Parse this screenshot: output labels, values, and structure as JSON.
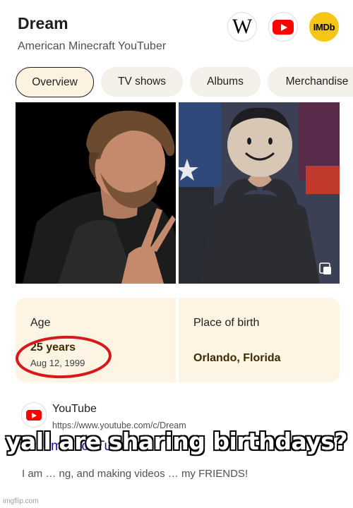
{
  "header": {
    "title": "Dream",
    "subtitle": "American Minecraft YouTuber"
  },
  "external_links": [
    {
      "name": "wikipedia",
      "glyph": "W"
    },
    {
      "name": "youtube",
      "glyph": ""
    },
    {
      "name": "imdb",
      "glyph": "IMDb"
    }
  ],
  "tabs": [
    {
      "label": "Overview",
      "active": true
    },
    {
      "label": "TV shows",
      "active": false
    },
    {
      "label": "Albums",
      "active": false
    },
    {
      "label": "Merchandise",
      "active": false
    }
  ],
  "images": [
    {
      "icon": "photo-of-person-making-peace-sign"
    },
    {
      "icon": "photo-of-masked-person-making-heart-hands"
    }
  ],
  "facts": {
    "age": {
      "label": "Age",
      "value": "25 years",
      "sub": "Aug 12, 1999"
    },
    "place_of_birth": {
      "label": "Place of birth",
      "value": "Orlando, Florida"
    }
  },
  "result": {
    "site": "YouTube",
    "url": "https://www.youtube.com/c/Dream",
    "title": "Dream - YouTube",
    "snippet": "I am … ng, and making videos … my FRIENDS!"
  },
  "meme_caption": "yall are sharing birthdays?",
  "watermark": "imgflip.com",
  "colors": {
    "fact_card_bg": "#fdf4e3",
    "link_blue": "#1a0dab",
    "circle_annotation": "#d7191c",
    "youtube_red": "#ff0000",
    "imdb_yellow": "#f5c518"
  }
}
